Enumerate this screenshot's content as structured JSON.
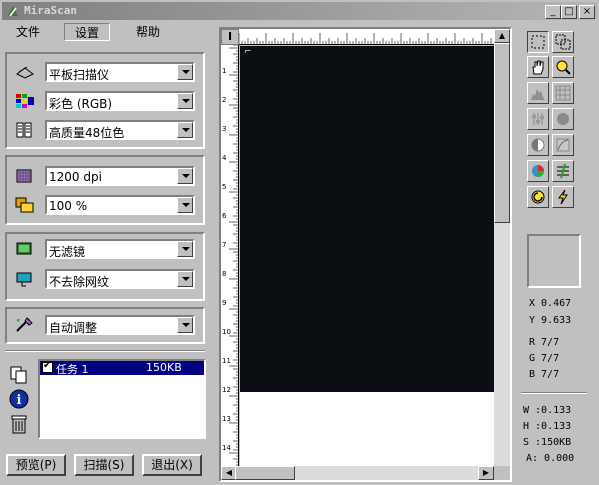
{
  "window": {
    "title": "MiraScan"
  },
  "menu": [
    "文件",
    "设置",
    "帮助"
  ],
  "scanner": {
    "type": "平板扫描仪",
    "color_mode": "彩色 (RGB)",
    "bit_depth": "高质量48位色"
  },
  "resolution": {
    "dpi": "1200 dpi",
    "scale": "100 %"
  },
  "filters": {
    "filter": "无滤镜",
    "descreen": "不去除网纹"
  },
  "adjust": {
    "mode": "自动调整"
  },
  "task": {
    "name": "任务 1",
    "size": "150KB",
    "checked": true
  },
  "buttons": {
    "preview": "预览(P)",
    "scan": "扫描(S)",
    "exit": "退出(X)"
  },
  "ruler": {
    "corner": "I",
    "v_ticks": [
      "1",
      "2",
      "3",
      "4",
      "5",
      "6",
      "7",
      "8",
      "9",
      "10",
      "11",
      "12",
      "13",
      "14"
    ]
  },
  "info": {
    "x": "X  0.467",
    "y": "Y  9.633",
    "r": "R  7/7",
    "g": "G  7/7",
    "b": "B  7/7",
    "w": "W :0.133",
    "h": "H :0.133",
    "s": "S :150KB",
    "a": "A: 0.000"
  },
  "colors": {
    "scan_area": "#0b0e12",
    "selection": "#000080"
  }
}
